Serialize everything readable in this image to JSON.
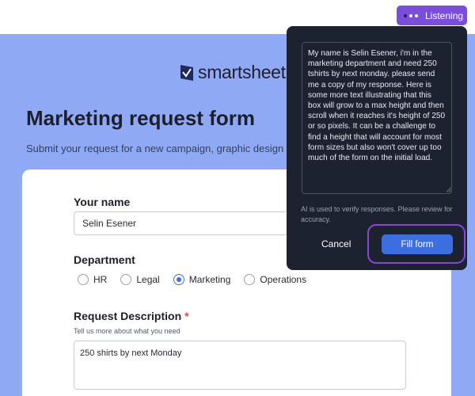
{
  "topbar": {
    "listening_label": "Listening"
  },
  "brand": {
    "name": "smartsheet"
  },
  "form": {
    "title": "Marketing request form",
    "subtitle": "Submit your request for a new campaign, graphic design",
    "name_label": "Your name",
    "name_value": "Selin Esener",
    "department_label": "Department",
    "departments": [
      {
        "label": "HR",
        "checked": false
      },
      {
        "label": "Legal",
        "checked": false
      },
      {
        "label": "Marketing",
        "checked": true
      },
      {
        "label": "Operations",
        "checked": false
      }
    ],
    "description_label": "Request Description",
    "required_marker": "*",
    "description_help": "Tell us more about what you need",
    "description_value": "250 shirts by next Monday"
  },
  "assistant": {
    "transcript": "My name is Selin Esener, i'm in the marketing department and need 250 tshirts by next monday. please send me a copy of my response. Here is some more text illustrating that this box will grow to a max height and then scroll when it reaches it's height of 250 or so pixels. It can be a challenge to find a height that will account for most form sizes but also won't cover up too much of the form on the initial load.",
    "note": "AI is used to verify responses. Please review for accuracy.",
    "cancel_label": "Cancel",
    "fill_label": "Fill form"
  },
  "colors": {
    "hero_background": "#8fa9f5",
    "accent_purple": "#7b4ddb",
    "primary_blue": "#3d6ee0",
    "popup_background": "#1d2230"
  }
}
